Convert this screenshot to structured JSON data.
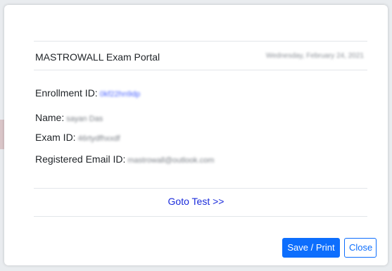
{
  "modal": {
    "portal_title": "MASTROWALL Exam Portal",
    "date_text": "Wednesday, February 24, 2021"
  },
  "details": {
    "enrollment_label": "Enrollment ID:",
    "enrollment_value": "0kf22hn9dp",
    "name_label": "Name:",
    "name_value": "sayan Das",
    "exam_label": "Exam ID:",
    "exam_value": "46rtydfhxxdf",
    "email_label": "Registered Email ID:",
    "email_value": "mastrowall@outlook.com"
  },
  "actions": {
    "goto_test": "Goto Test >>",
    "save_print": "Save / Print",
    "close": "Close"
  },
  "colors": {
    "primary": "#0d6efd",
    "link": "#1a2bdb"
  }
}
